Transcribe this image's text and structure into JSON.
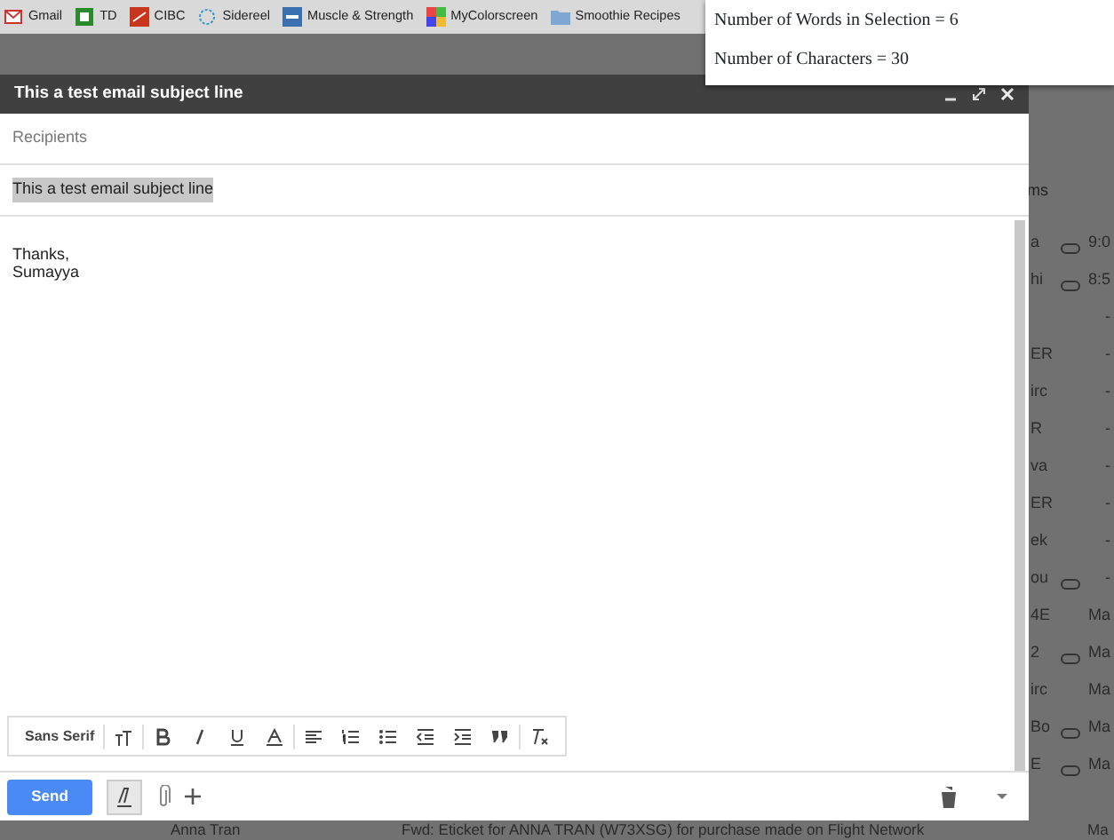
{
  "bookmarks": [
    {
      "label": "Gmail"
    },
    {
      "label": "TD"
    },
    {
      "label": "CIBC"
    },
    {
      "label": "Sidereel"
    },
    {
      "label": "Muscle & Strength"
    },
    {
      "label": "MyColorscreen"
    },
    {
      "label": "Smoothie Recipes"
    }
  ],
  "popup": {
    "lines": [
      "Number of Words in Selection = 6",
      "Number of Characters = 30"
    ]
  },
  "inbox": {
    "header": "ms",
    "rows": [
      {
        "sender": "a",
        "attachment": true,
        "time": "9:0"
      },
      {
        "sender": "hi",
        "attachment": true,
        "time": "8:5"
      },
      {
        "sender": "",
        "attachment": false,
        "time": "-"
      },
      {
        "sender": "ER",
        "attachment": false,
        "time": "-"
      },
      {
        "sender": "irc",
        "attachment": false,
        "time": "-"
      },
      {
        "sender": "R",
        "attachment": false,
        "time": "-"
      },
      {
        "sender": "va",
        "attachment": false,
        "time": "-"
      },
      {
        "sender": "ER",
        "attachment": false,
        "time": "-"
      },
      {
        "sender": "ek",
        "attachment": false,
        "time": "-"
      },
      {
        "sender": "ou",
        "attachment": true,
        "time": "-"
      },
      {
        "sender": "4E",
        "attachment": false,
        "time": "Ma"
      },
      {
        "sender": "2",
        "attachment": true,
        "time": "Ma"
      },
      {
        "sender": "irc",
        "attachment": false,
        "time": "Ma"
      },
      {
        "sender": "Bo",
        "attachment": true,
        "time": "Ma"
      },
      {
        "sender": "E",
        "attachment": true,
        "time": "Ma"
      }
    ],
    "bottom_row": {
      "sender": "Anna Tran",
      "subject": "Fwd: Eticket for ANNA TRAN (W73XSG) for purchase made on Flight Network",
      "time": "Ma"
    }
  },
  "compose": {
    "title": "This a test email subject line",
    "recipients_placeholder": "Recipients",
    "subject": "This a test email subject line",
    "subject_selected": true,
    "body": [
      "Thanks,",
      "Sumayya"
    ],
    "font": "Sans Serif",
    "send": "Send",
    "formatting_active": true
  }
}
